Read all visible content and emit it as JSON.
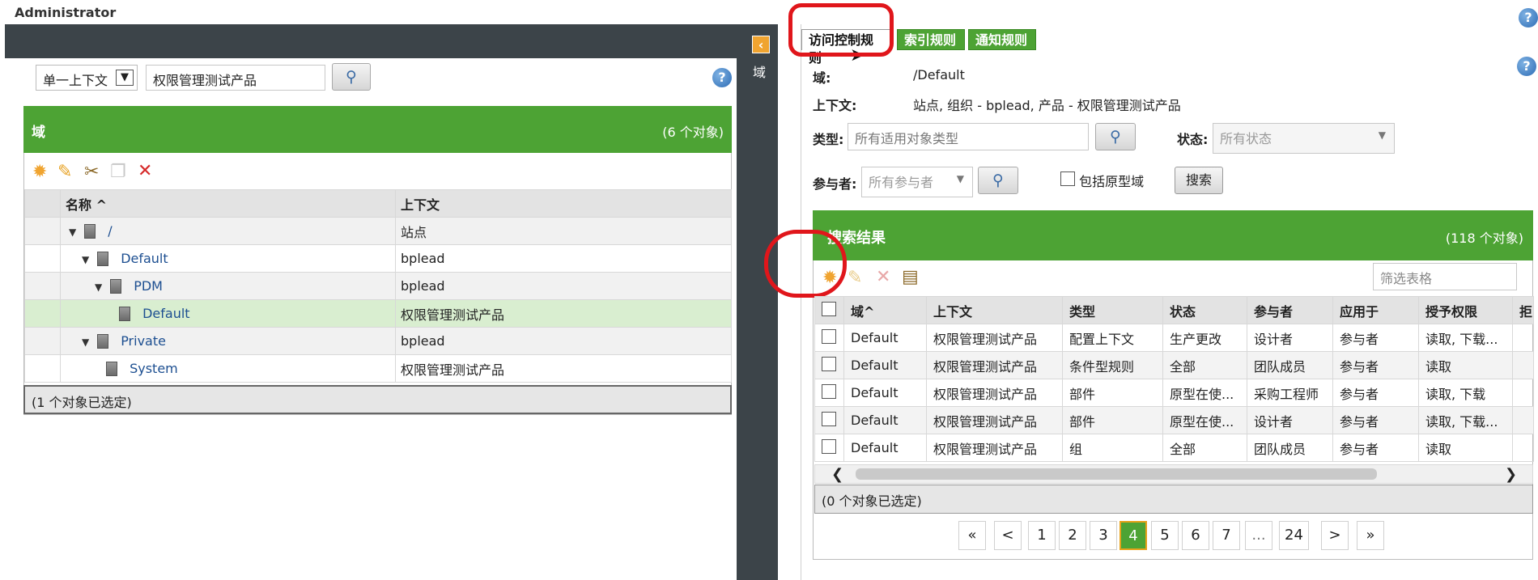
{
  "header": {
    "title": "Administrator",
    "help_icon": "question-circle-icon"
  },
  "left": {
    "context_select": "单一上下文",
    "search_value": "权限管理测试产品",
    "collapse_icon": "‹",
    "strip_label": "域",
    "panel_title": "域",
    "panel_count": "(6 个对象)",
    "table": {
      "headers": [
        "名称 ^",
        "上下文"
      ],
      "rows": [
        {
          "name": "/",
          "context": "站点"
        },
        {
          "name": "Default",
          "context": "bplead"
        },
        {
          "name": "PDM",
          "context": "bplead"
        },
        {
          "name": "Default",
          "context": "权限管理测试产品"
        },
        {
          "name": "Private",
          "context": "bplead"
        },
        {
          "name": "System",
          "context": "权限管理测试产品"
        }
      ]
    },
    "status": "(1 个对象已选定)"
  },
  "right": {
    "tabs": [
      "访问控制规则",
      "索引规则",
      "通知规则"
    ],
    "domain_label": "域:",
    "domain_value": "/Default",
    "context_label": "上下文:",
    "context_value": "站点, 组织 - bplead, 产品 - 权限管理测试产品",
    "type_label": "类型:",
    "type_placeholder": "所有适用对象类型",
    "state_label": "状态:",
    "state_value": "所有状态",
    "participant_label": "参与者:",
    "participant_value": "所有参与者",
    "include_proto_label": "包括原型域",
    "search_button": "搜索",
    "results_title": "搜索结果",
    "results_count": "(118 个对象)",
    "filter_placeholder": "筛选表格",
    "table": {
      "headers": [
        "域^",
        "上下文",
        "类型",
        "状态",
        "参与者",
        "应用于",
        "授予权限",
        "拒"
      ],
      "rows": [
        [
          "Default",
          "权限管理测试产品",
          "配置上下文",
          "生产更改",
          "设计者",
          "参与者",
          "读取, 下载..."
        ],
        [
          "Default",
          "权限管理测试产品",
          "条件型规则",
          "全部",
          "团队成员",
          "参与者",
          "读取"
        ],
        [
          "Default",
          "权限管理测试产品",
          "部件",
          "原型在使...",
          "采购工程师",
          "参与者",
          "读取, 下载"
        ],
        [
          "Default",
          "权限管理测试产品",
          "部件",
          "原型在使...",
          "设计者",
          "参与者",
          "读取, 下载..."
        ],
        [
          "Default",
          "权限管理测试产品",
          "组",
          "全部",
          "团队成员",
          "参与者",
          "读取"
        ]
      ]
    },
    "status": "(0 个对象已选定)",
    "pagination": [
      "«",
      "<",
      "1",
      "2",
      "3",
      "4",
      "5",
      "6",
      "7",
      "...",
      "24",
      ">",
      "»"
    ],
    "current_page": "4"
  },
  "colors": {
    "green": "#4da334",
    "dark_frame": "#3c4449",
    "annotation": "#e0161b"
  }
}
